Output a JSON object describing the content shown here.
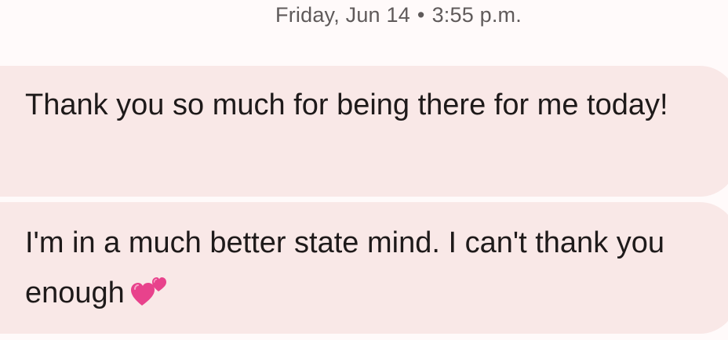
{
  "conversation": {
    "timestamp": {
      "day": "Friday, Jun 14",
      "separator": "•",
      "time": "3:55 p.m."
    },
    "messages": [
      {
        "text": "Thank you so much for being there for me today!"
      },
      {
        "text": "I'm in a much better state mind. I can't thank you enough",
        "emoji": "two-hearts-icon"
      }
    ]
  },
  "colors": {
    "background": "#fffafa",
    "bubble": "#f9e8e7",
    "text": "#1e1a1a",
    "timestamp": "#5f5a5a",
    "heart": "#e8428c"
  }
}
